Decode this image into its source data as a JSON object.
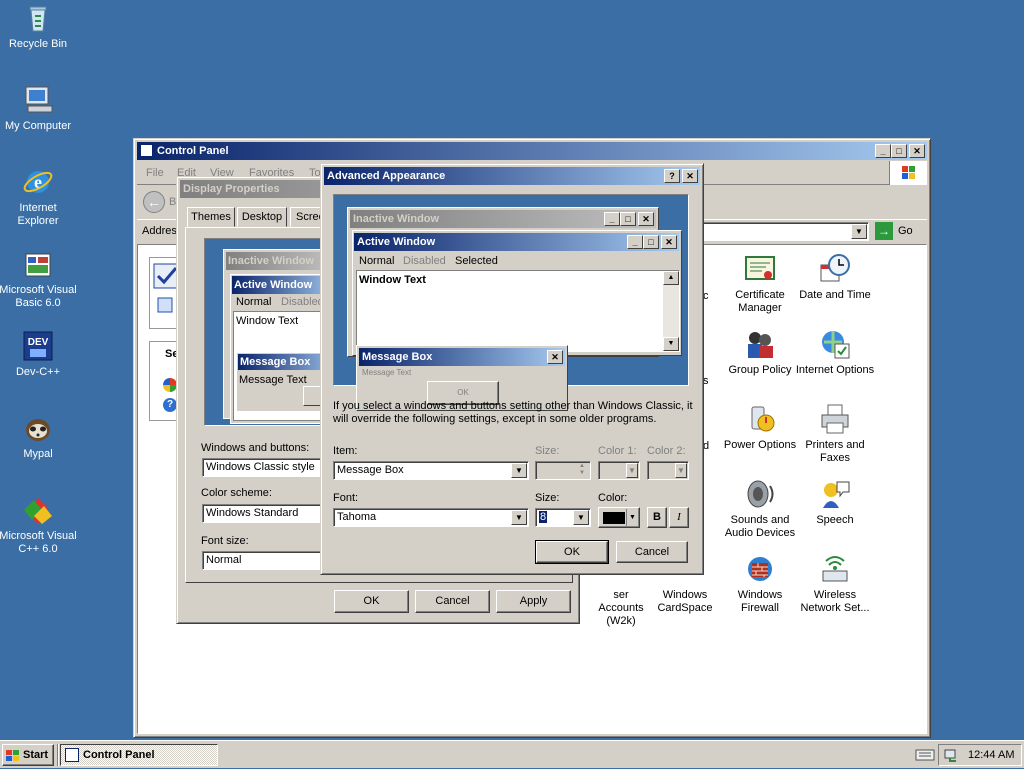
{
  "desktop": {
    "icons": [
      {
        "label": "Recycle Bin",
        "icon": "recycle-bin-icon"
      },
      {
        "label": "My Computer",
        "icon": "my-computer-icon"
      },
      {
        "label": "Internet Explorer",
        "icon": "internet-explorer-icon"
      },
      {
        "label": "Microsoft Visual Basic 6.0",
        "icon": "visual-basic-icon"
      },
      {
        "label": "Dev-C++",
        "icon": "dev-cpp-icon"
      },
      {
        "label": "Mypal",
        "icon": "mypal-icon"
      },
      {
        "label": "Microsoft Visual C++ 6.0",
        "icon": "visual-cpp-icon"
      }
    ]
  },
  "control_panel": {
    "title": "Control Panel",
    "menu": [
      "File",
      "Edit",
      "View",
      "Favorites",
      "To"
    ],
    "back_label": "Ba",
    "address_label": "Address",
    "go_label": "Go",
    "side_title": "See",
    "items": [
      {
        "label": "Certificate Manager",
        "icon": "certificate-icon"
      },
      {
        "label": "Date and Time",
        "icon": "clock-icon"
      },
      {
        "label": "Group Policy",
        "icon": "group-policy-icon"
      },
      {
        "label": "Internet Options",
        "icon": "internet-options-icon"
      },
      {
        "label": "Power Options",
        "icon": "power-icon"
      },
      {
        "label": "Printers and Faxes",
        "icon": "printer-icon"
      },
      {
        "label": "Sounds and Audio Devices",
        "icon": "speaker-icon"
      },
      {
        "label": "Speech",
        "icon": "speech-icon"
      },
      {
        "label": "ser Accounts (W2k)",
        "icon": "user-accounts-icon"
      },
      {
        "label": "Windows CardSpace",
        "icon": "cardspace-icon"
      },
      {
        "label": "Windows Firewall",
        "icon": "firewall-icon"
      },
      {
        "label": "Wireless Network Set...",
        "icon": "wireless-icon"
      }
    ],
    "partial_c": "c",
    "partial_s": "s",
    "partial_d": "d"
  },
  "display_properties": {
    "title": "Display Properties",
    "tabs": [
      "Themes",
      "Desktop",
      "Scree"
    ],
    "preview": {
      "inactive_title": "Inactive Window",
      "active_title": "Active Window",
      "normal": "Normal",
      "disabled": "Disabled",
      "window_text": "Window Text",
      "message_box": "Message Box",
      "message_text": "Message Text"
    },
    "windows_buttons_label": "Windows and buttons:",
    "windows_buttons_value": "Windows Classic style",
    "color_scheme_label": "Color scheme:",
    "color_scheme_value": "Windows Standard",
    "font_size_label": "Font size:",
    "font_size_value": "Normal",
    "ok": "OK",
    "cancel": "Cancel",
    "apply": "Apply"
  },
  "advanced_appearance": {
    "title": "Advanced Appearance",
    "help": "?",
    "close": "✕",
    "preview": {
      "inactive_title": "Inactive Window",
      "active_title": "Active Window",
      "menu_normal": "Normal",
      "menu_disabled": "Disabled",
      "menu_selected": "Selected",
      "window_text": "Window Text",
      "message_box_title": "Message Box",
      "message_text": "Message Text",
      "ok": "OK"
    },
    "info": "If you select a windows and buttons setting other than Windows Classic, it will override the following settings, except in some older programs.",
    "item_label": "Item:",
    "item_value": "Message Box",
    "size_label_1": "Size:",
    "color1_label": "Color 1:",
    "color2_label": "Color 2:",
    "font_label": "Font:",
    "font_value": "Tahoma",
    "size_label_2": "Size:",
    "size_value": "8",
    "color_label": "Color:",
    "bold": "B",
    "italic": "I",
    "ok": "OK",
    "cancel": "Cancel"
  },
  "taskbar": {
    "start": "Start",
    "task": "Control Panel",
    "clock": "12:44 AM"
  }
}
